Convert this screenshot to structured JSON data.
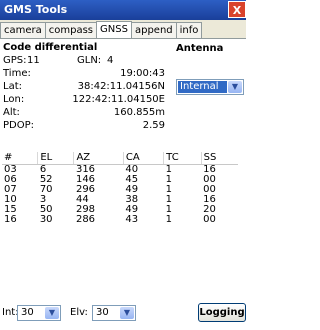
{
  "window": {
    "title": "GMS Tools",
    "close_label": "X"
  },
  "tabs": [
    "camera",
    "compass",
    "GNSS",
    "append",
    "info"
  ],
  "active_tab": "GNSS",
  "gnss": {
    "heading": "Code differential",
    "gps_label": "GPS:",
    "gps_value": "11",
    "glon_label": "GLN:",
    "glon_value": "4",
    "time_label": "Time:",
    "time_value": "19:00:43",
    "lat_label": "Lat:",
    "lat_value": "38:42:11.04156N",
    "lon_label": "Lon:",
    "lon_value": "122:42:11.04150E",
    "alt_label": "Alt:",
    "alt_value": "160.855m",
    "pdop_label": "PDOP:",
    "pdop_value": "2.59"
  },
  "antenna": {
    "title": "Antenna",
    "selected": "Internal"
  },
  "satellites": {
    "headers": [
      "#",
      "EL",
      "AZ",
      "CA",
      "TC",
      "SS"
    ],
    "rows": [
      [
        "03",
        "6",
        "316",
        "40",
        "1",
        "16"
      ],
      [
        "06",
        "52",
        "146",
        "45",
        "1",
        "00"
      ],
      [
        "07",
        "70",
        "296",
        "49",
        "1",
        "00"
      ],
      [
        "10",
        "3",
        "44",
        "38",
        "1",
        "16"
      ],
      [
        "15",
        "50",
        "298",
        "49",
        "1",
        "20"
      ],
      [
        "16",
        "30",
        "286",
        "43",
        "1",
        "00"
      ]
    ]
  },
  "bottom": {
    "int_label": "Int:",
    "int_value": "30",
    "elv_label": "Elv:",
    "elv_value": "30",
    "logging_label": "Logging"
  },
  "colors": {
    "titlebar": "#2d5fc4",
    "selection": "#316ac5",
    "close": "#d9432c"
  }
}
